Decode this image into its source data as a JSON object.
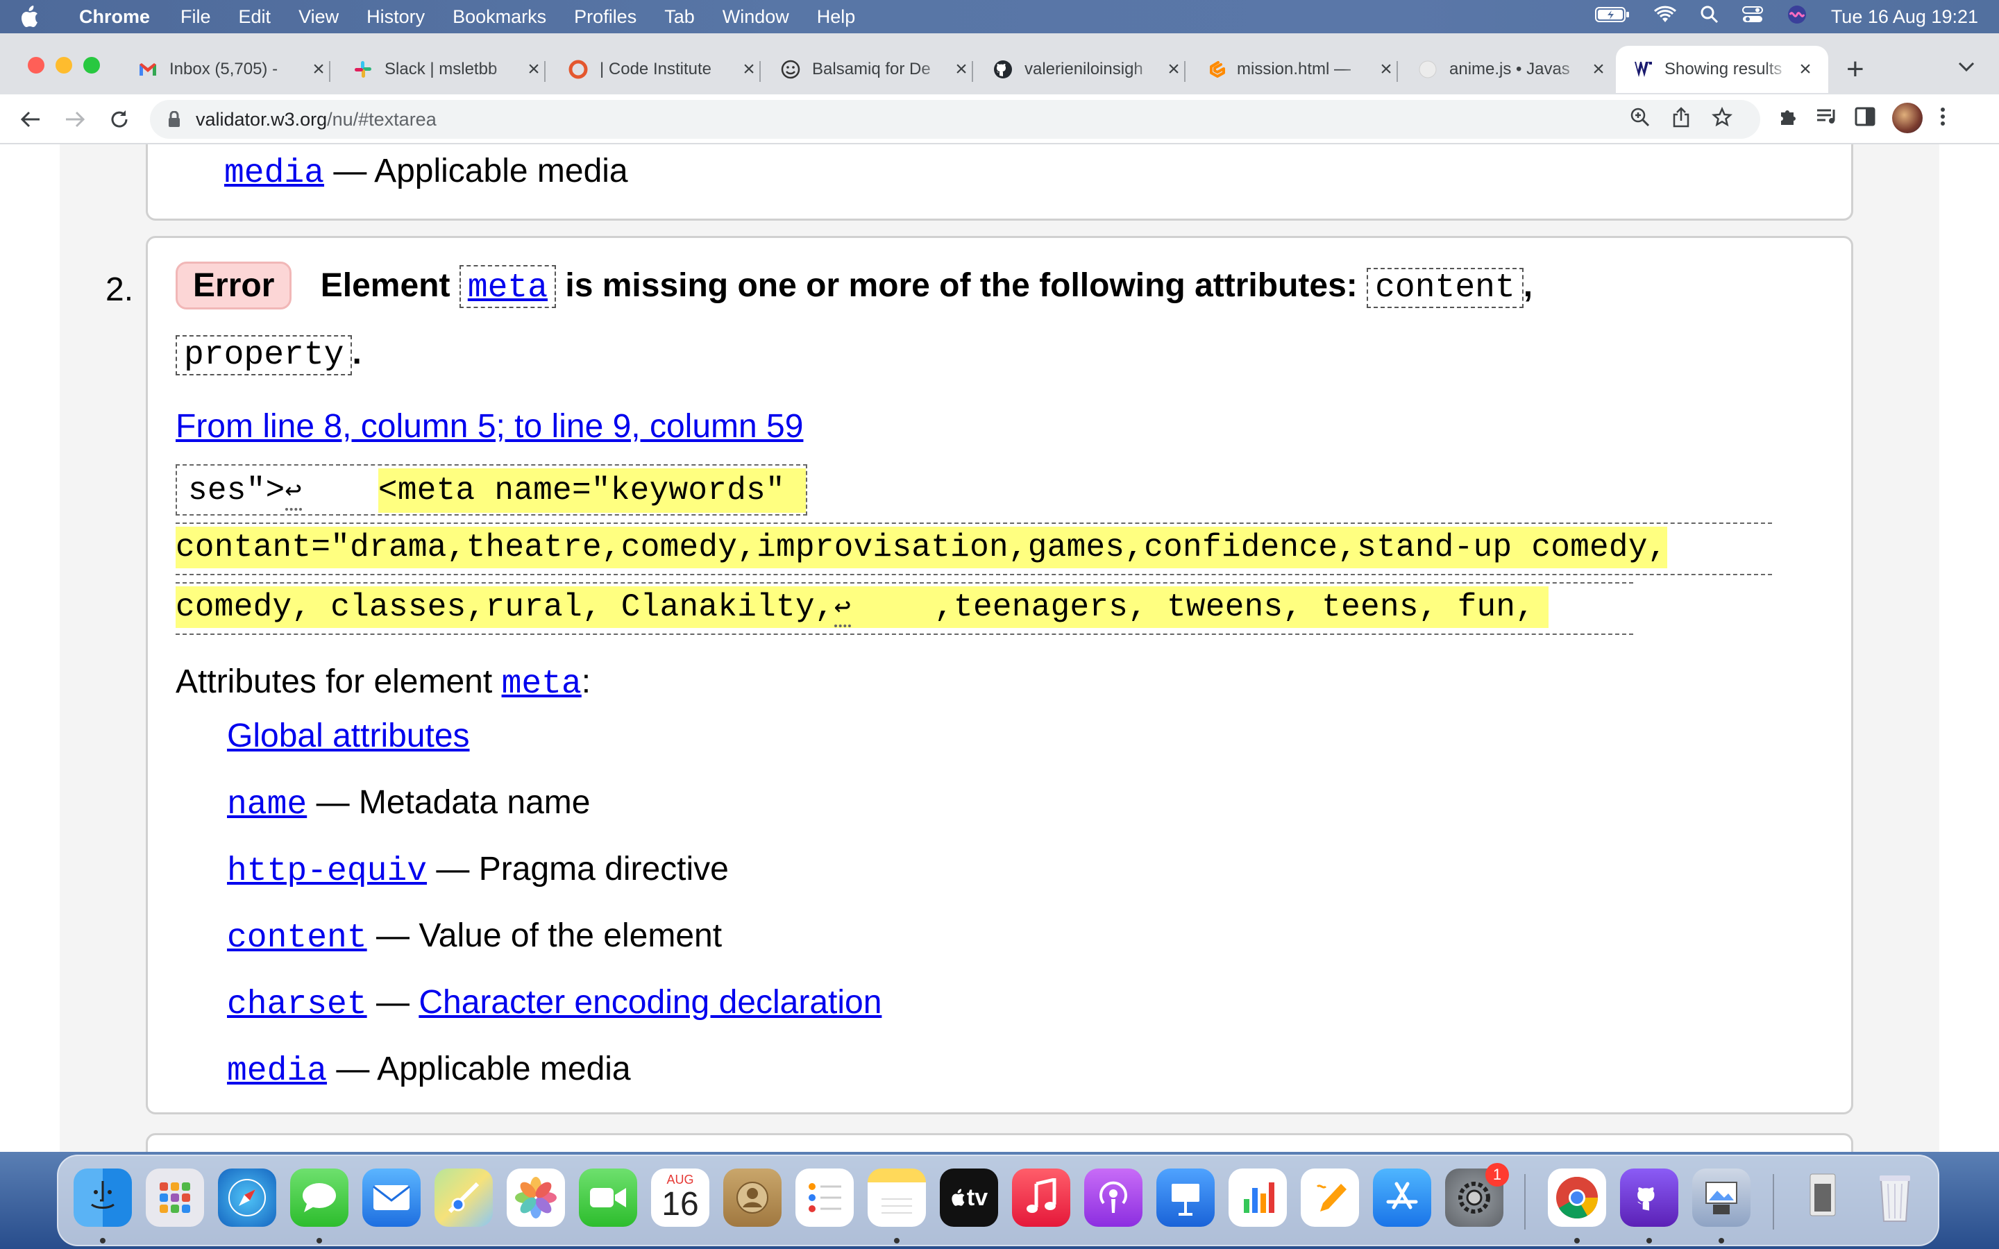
{
  "menubar": {
    "app": "Chrome",
    "items": [
      "File",
      "Edit",
      "View",
      "History",
      "Bookmarks",
      "Profiles",
      "Tab",
      "Window",
      "Help"
    ],
    "clock": "Tue 16 Aug  19:21"
  },
  "tabs": [
    {
      "title": "Inbox (5,705) -",
      "icon": "gmail-icon"
    },
    {
      "title": "Slack | msletbb",
      "icon": "slack-icon"
    },
    {
      "title": "| Code Institute",
      "icon": "code-institute-icon"
    },
    {
      "title": "Balsamiq for De",
      "icon": "balsamiq-icon"
    },
    {
      "title": "valerieniloinsigh",
      "icon": "github-icon"
    },
    {
      "title": "mission.html —",
      "icon": "gitpod-icon"
    },
    {
      "title": "anime.js • Javas",
      "icon": "anime-icon"
    },
    {
      "title": "Showing results",
      "icon": "w3c-validator-icon"
    }
  ],
  "address": {
    "host": "validator.w3.org",
    "path": "/nu/#textarea"
  },
  "prev_card": {
    "attr": "media",
    "desc": "— Applicable media"
  },
  "message": {
    "number": "2.",
    "type": "Error",
    "text_part1": "Element",
    "element": "meta",
    "text_part2": "is missing one or more of the following attributes:",
    "attr1": "content",
    "comma": ",",
    "attr2": "property",
    "period": ".",
    "location": "From line 8, column 5; to line 9, column 59",
    "extract": {
      "line1_plain": "ses\">",
      "return_glyph": "↩",
      "line1_hl": "<meta name=\"keywords\"",
      "line2": "contant=\"drama,theatre,comedy,improvisation,games,confidence,stand-up comedy,",
      "line3_a": "comedy, classes,rural, Clanakilty,",
      "line3_b": ",teenagers, tweens, teens, fun,"
    },
    "attrs_heading": "Attributes for element",
    "attrs_heading_element": "meta",
    "attrs_colon": ":",
    "global_link": "Global attributes",
    "attributes": [
      {
        "name": "name",
        "sep": "—",
        "desc": "Metadata name",
        "desc_link": false
      },
      {
        "name": "http-equiv",
        "sep": "—",
        "desc": "Pragma directive",
        "desc_link": false
      },
      {
        "name": "content",
        "sep": "—",
        "desc": "Value of the element",
        "desc_link": false
      },
      {
        "name": "charset",
        "sep": "—",
        "desc": "Character encoding declaration",
        "desc_link": true
      },
      {
        "name": "media",
        "sep": "—",
        "desc": "Applicable media",
        "desc_link": false
      }
    ]
  },
  "dock": {
    "calendar_month": "AUG",
    "calendar_day": "16",
    "appletv_label": "tv",
    "settings_badge": "1",
    "apps": [
      "Finder",
      "Launchpad",
      "Safari",
      "Messages",
      "Mail",
      "Maps",
      "Photos",
      "FaceTime",
      "Calendar",
      "Contacts",
      "Reminders",
      "Notes",
      "Apple TV",
      "Music",
      "Podcasts",
      "Keynote",
      "Numbers",
      "Pages",
      "App Store",
      "System Preferences",
      "Chrome",
      "GitHub Desktop",
      "Preview",
      "Downloads",
      "Trash"
    ]
  },
  "colors": {
    "error_bg": "#fcd6d6",
    "highlight": "#ffff80",
    "link": "#0000ee"
  }
}
